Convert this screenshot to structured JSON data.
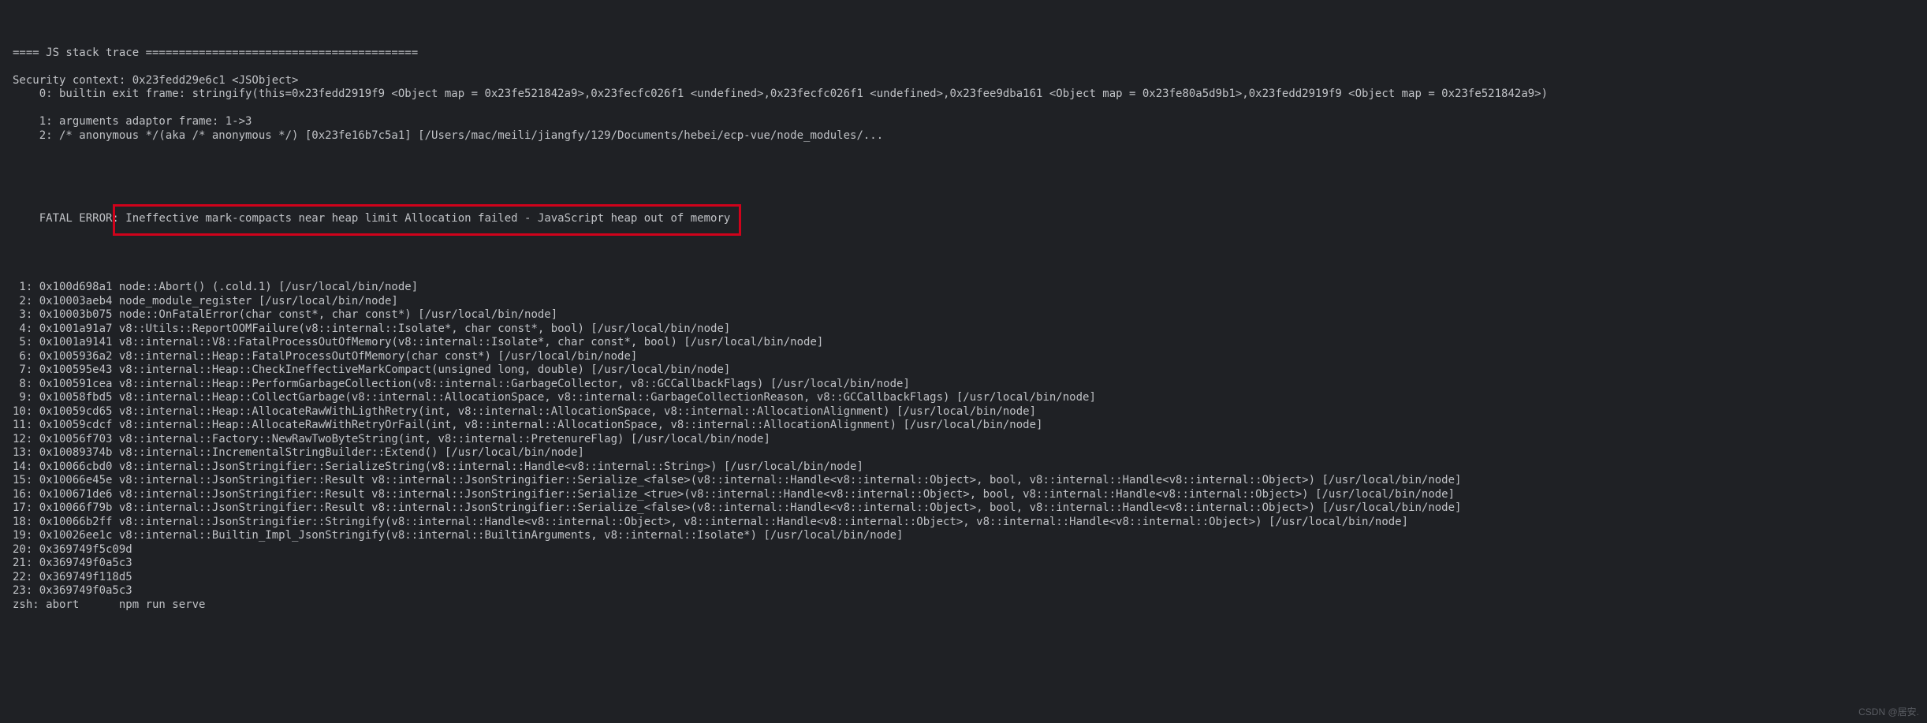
{
  "colors": {
    "background": "#1f2125",
    "text": "#c0c2c6",
    "highlight_border": "#d0021b"
  },
  "fatal_error": {
    "prefix": "FATAL ERROR:",
    "message": " Ineffective mark-compacts near heap limit Allocation failed - JavaScript heap out of memory"
  },
  "lines_before": [
    "==== JS stack trace =========================================",
    "",
    "Security context: 0x23fedd29e6c1 <JSObject>",
    "    0: builtin exit frame: stringify(this=0x23fedd2919f9 <Object map = 0x23fe521842a9>,0x23fecfc026f1 <undefined>,0x23fecfc026f1 <undefined>,0x23fee9dba161 <Object map = 0x23fe80a5d9b1>,0x23fedd2919f9 <Object map = 0x23fe521842a9>)",
    "",
    "    1: arguments adaptor frame: 1->3",
    "    2: /* anonymous */(aka /* anonymous */) [0x23fe16b7c5a1] [/Users/mac/meili/jiangfy/129/Documents/hebei/ecp-vue/node_modules/...",
    ""
  ],
  "lines_after": [
    " 1: 0x100d698a1 node::Abort() (.cold.1) [/usr/local/bin/node]",
    " 2: 0x10003aeb4 node_module_register [/usr/local/bin/node]",
    " 3: 0x10003b075 node::OnFatalError(char const*, char const*) [/usr/local/bin/node]",
    " 4: 0x1001a91a7 v8::Utils::ReportOOMFailure(v8::internal::Isolate*, char const*, bool) [/usr/local/bin/node]",
    " 5: 0x1001a9141 v8::internal::V8::FatalProcessOutOfMemory(v8::internal::Isolate*, char const*, bool) [/usr/local/bin/node]",
    " 6: 0x1005936a2 v8::internal::Heap::FatalProcessOutOfMemory(char const*) [/usr/local/bin/node]",
    " 7: 0x100595e43 v8::internal::Heap::CheckIneffectiveMarkCompact(unsigned long, double) [/usr/local/bin/node]",
    " 8: 0x100591cea v8::internal::Heap::PerformGarbageCollection(v8::internal::GarbageCollector, v8::GCCallbackFlags) [/usr/local/bin/node]",
    " 9: 0x10058fbd5 v8::internal::Heap::CollectGarbage(v8::internal::AllocationSpace, v8::internal::GarbageCollectionReason, v8::GCCallbackFlags) [/usr/local/bin/node]",
    "10: 0x10059cd65 v8::internal::Heap::AllocateRawWithLigthRetry(int, v8::internal::AllocationSpace, v8::internal::AllocationAlignment) [/usr/local/bin/node]",
    "11: 0x10059cdcf v8::internal::Heap::AllocateRawWithRetryOrFail(int, v8::internal::AllocationSpace, v8::internal::AllocationAlignment) [/usr/local/bin/node]",
    "12: 0x10056f703 v8::internal::Factory::NewRawTwoByteString(int, v8::internal::PretenureFlag) [/usr/local/bin/node]",
    "13: 0x10089374b v8::internal::IncrementalStringBuilder::Extend() [/usr/local/bin/node]",
    "14: 0x10066cbd0 v8::internal::JsonStringifier::SerializeString(v8::internal::Handle<v8::internal::String>) [/usr/local/bin/node]",
    "15: 0x10066e45e v8::internal::JsonStringifier::Result v8::internal::JsonStringifier::Serialize_<false>(v8::internal::Handle<v8::internal::Object>, bool, v8::internal::Handle<v8::internal::Object>) [/usr/local/bin/node]",
    "16: 0x100671de6 v8::internal::JsonStringifier::Result v8::internal::JsonStringifier::Serialize_<true>(v8::internal::Handle<v8::internal::Object>, bool, v8::internal::Handle<v8::internal::Object>) [/usr/local/bin/node]",
    "17: 0x10066f79b v8::internal::JsonStringifier::Result v8::internal::JsonStringifier::Serialize_<false>(v8::internal::Handle<v8::internal::Object>, bool, v8::internal::Handle<v8::internal::Object>) [/usr/local/bin/node]",
    "18: 0x10066b2ff v8::internal::JsonStringifier::Stringify(v8::internal::Handle<v8::internal::Object>, v8::internal::Handle<v8::internal::Object>, v8::internal::Handle<v8::internal::Object>) [/usr/local/bin/node]",
    "19: 0x10026ee1c v8::internal::Builtin_Impl_JsonStringify(v8::internal::BuiltinArguments, v8::internal::Isolate*) [/usr/local/bin/node]",
    "20: 0x369749f5c09d",
    "21: 0x369749f0a5c3",
    "22: 0x369749f118d5",
    "23: 0x369749f0a5c3",
    "zsh: abort      npm run serve"
  ],
  "watermark": "CSDN @居安."
}
